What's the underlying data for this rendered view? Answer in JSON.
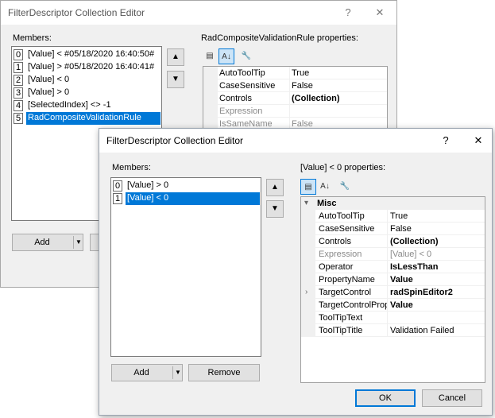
{
  "back_dialog": {
    "title": "FilterDescriptor Collection Editor",
    "help_glyph": "?",
    "close_glyph": "✕",
    "members_label": "Members:",
    "properties_label": "RadCompositeValidationRule properties:",
    "members": [
      {
        "index": "0",
        "text": "[Value] < #05/18/2020 16:40:50#",
        "selected": false
      },
      {
        "index": "1",
        "text": "[Value] > #05/18/2020 16:40:41#",
        "selected": false
      },
      {
        "index": "2",
        "text": "[Value] < 0",
        "selected": false
      },
      {
        "index": "3",
        "text": "[Value] > 0",
        "selected": false
      },
      {
        "index": "4",
        "text": "[SelectedIndex] <> -1",
        "selected": false
      },
      {
        "index": "5",
        "text": "RadCompositeValidationRule",
        "selected": true
      }
    ],
    "move_up_glyph": "▲",
    "move_down_glyph": "▼",
    "add_label": "Add",
    "dropdown_glyph": "▼",
    "properties": [
      {
        "name": "AutoToolTip",
        "value": "True",
        "style": "normal"
      },
      {
        "name": "CaseSensitive",
        "value": "False",
        "style": "normal"
      },
      {
        "name": "Controls",
        "value": "(Collection)",
        "style": "bold"
      },
      {
        "name": "Expression",
        "value": "",
        "style": "dim"
      },
      {
        "name": "IsSameName",
        "value": "False",
        "style": "dim"
      }
    ]
  },
  "front_dialog": {
    "title": "FilterDescriptor Collection Editor",
    "help_glyph": "?",
    "close_glyph": "✕",
    "members_label": "Members:",
    "properties_label": "[Value] < 0 properties:",
    "members": [
      {
        "index": "0",
        "text": "[Value] > 0",
        "selected": false
      },
      {
        "index": "1",
        "text": "[Value] < 0",
        "selected": true
      }
    ],
    "move_up_glyph": "▲",
    "move_down_glyph": "▼",
    "add_label": "Add",
    "dropdown_glyph": "▼",
    "remove_label": "Remove",
    "category": {
      "glyph": "▾",
      "name": "Misc"
    },
    "properties": [
      {
        "name": "AutoToolTip",
        "value": "True",
        "style": "normal"
      },
      {
        "name": "CaseSensitive",
        "value": "False",
        "style": "normal"
      },
      {
        "name": "Controls",
        "value": "(Collection)",
        "style": "bold"
      },
      {
        "name": "Expression",
        "value": "[Value] < 0",
        "style": "dim"
      },
      {
        "name": "Operator",
        "value": "IsLessThan",
        "style": "bold"
      },
      {
        "name": "PropertyName",
        "value": "Value",
        "style": "bold"
      },
      {
        "name": "TargetControl",
        "value": "radSpinEditor2",
        "style": "bold",
        "expandable": true,
        "expander_glyph": "›"
      },
      {
        "name": "TargetControlPrope",
        "value": "Value",
        "style": "bold"
      },
      {
        "name": "ToolTipText",
        "value": "",
        "style": "normal"
      },
      {
        "name": "ToolTipTitle",
        "value": "Validation Failed",
        "style": "normal"
      }
    ],
    "ok_label": "OK",
    "cancel_label": "Cancel"
  },
  "toolbar": {
    "categorized_glyph": "▤",
    "alphabetical_glyph": "A↓",
    "property_pages_glyph": "🔧"
  }
}
